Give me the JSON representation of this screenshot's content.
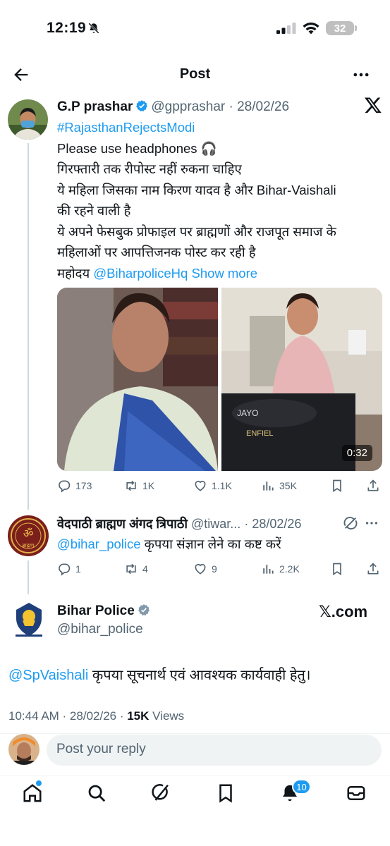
{
  "status_bar": {
    "time": "12:19",
    "battery": "32"
  },
  "topbar": {
    "title": "Post"
  },
  "main_tweet": {
    "author_name": "G.P prashar",
    "handle": "@gpprashar",
    "date": "· 28/02/26",
    "hashtag": "#RajasthanRejectsModi",
    "line1": "Please use headphones 🎧",
    "line2": "गिरफ्तारी तक रीपोस्ट नहीं रुकना चाहिए",
    "line3": "ये महिला जिसका नाम किरण यादव है और Bihar-Vaishali",
    "line4": "की रहने वाली है",
    "line5": "ये अपने फेसबुक प्रोफाइल पर ब्राह्मणों और राजपूत समाज के",
    "line6": "महिलाओं पर आपत्तिजनक पोस्ट कर रही है",
    "line7_prefix": "महोदय ",
    "line7_mention": "@BiharpoliceHq",
    "show_more": "Show more",
    "video_duration": "0:32",
    "stats": {
      "replies": "173",
      "reposts": "1K",
      "likes": "1.1K",
      "views": "35K"
    }
  },
  "reply_tweet": {
    "author_name": "वेदपाठी ब्राह्मण अंगद त्रिपाठी",
    "handle": "@tiwar...",
    "date": "· 28/02/26",
    "mention": "@bihar_police",
    "text": " कृपया संज्ञान लेने का कष्ट करें",
    "stats": {
      "replies": "1",
      "reposts": "4",
      "likes": "9",
      "views": "2.2K"
    }
  },
  "focused_tweet": {
    "author_name": "Bihar Police",
    "handle": "@bihar_police",
    "watermark": "𝕏.com",
    "mention": "@SpVaishali",
    "text": " कृपया सूचनार्थ एवं आवश्यक कार्यवाही हेतु।",
    "time": "10:44 AM · 28/02/26 · ",
    "views_count": "15K",
    "views_label": " Views"
  },
  "reply_bar": {
    "placeholder": "Post your reply"
  },
  "bottom_nav": {
    "notifications_badge": "10"
  },
  "colors": {
    "accent": "#1d9bf0",
    "text": "#0f1419",
    "secondary": "#536471"
  }
}
